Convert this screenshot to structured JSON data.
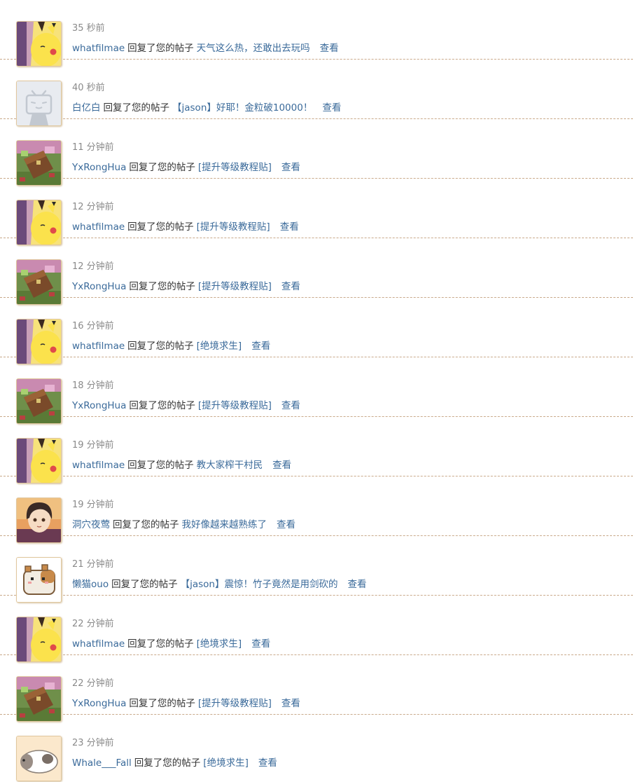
{
  "notifications": [
    {
      "time": "35 秒前",
      "user": "whatfilmae",
      "verb": "回复了您的帖子",
      "thread": "天气这么热，还敢出去玩吗",
      "view": "查看",
      "avatar": "pikachu"
    },
    {
      "time": "40 秒前",
      "user": "白亿白",
      "verb": "回复了您的帖子",
      "thread": "【jason】好耶！金粒破10000！",
      "view": "查看",
      "avatar": "default"
    },
    {
      "time": "11 分钟前",
      "user": "YxRongHua",
      "verb": "回复了您的帖子",
      "thread": "[提升等级教程贴]",
      "view": "查看",
      "avatar": "chest"
    },
    {
      "time": "12 分钟前",
      "user": "whatfilmae",
      "verb": "回复了您的帖子",
      "thread": "[提升等级教程贴]",
      "view": "查看",
      "avatar": "pikachu"
    },
    {
      "time": "12 分钟前",
      "user": "YxRongHua",
      "verb": "回复了您的帖子",
      "thread": "[提升等级教程贴]",
      "view": "查看",
      "avatar": "chest"
    },
    {
      "time": "16 分钟前",
      "user": "whatfilmae",
      "verb": "回复了您的帖子",
      "thread": "[绝境求生]",
      "view": "查看",
      "avatar": "pikachu"
    },
    {
      "time": "18 分钟前",
      "user": "YxRongHua",
      "verb": "回复了您的帖子",
      "thread": "[提升等级教程贴]",
      "view": "查看",
      "avatar": "chest"
    },
    {
      "time": "19 分钟前",
      "user": "whatfilmae",
      "verb": "回复了您的帖子",
      "thread": "教大家榨干村民",
      "view": "查看",
      "avatar": "pikachu"
    },
    {
      "time": "19 分钟前",
      "user": "洞穴夜莺",
      "verb": "回复了您的帖子",
      "thread": "我好像越来越熟练了",
      "view": "查看",
      "avatar": "anime"
    },
    {
      "time": "21 分钟前",
      "user": "懒猫ouo",
      "verb": "回复了您的帖子",
      "thread": "【jason】震惊！竹子竟然是用剑砍的",
      "view": "查看",
      "avatar": "hamster"
    },
    {
      "time": "22 分钟前",
      "user": "whatfilmae",
      "verb": "回复了您的帖子",
      "thread": "[绝境求生]",
      "view": "查看",
      "avatar": "pikachu"
    },
    {
      "time": "22 分钟前",
      "user": "YxRongHua",
      "verb": "回复了您的帖子",
      "thread": "[提升等级教程贴]",
      "view": "查看",
      "avatar": "chest"
    },
    {
      "time": "23 分钟前",
      "user": "Whale___Fall",
      "verb": "回复了您的帖子",
      "thread": "[绝境求生]",
      "view": "查看",
      "avatar": "guinea-pig"
    }
  ]
}
